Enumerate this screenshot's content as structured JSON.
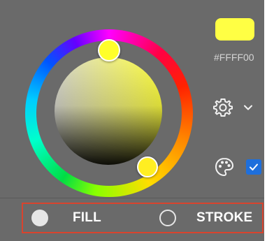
{
  "color": {
    "current_hex": "#FFFF00",
    "swatch_color": "#FFFF44"
  },
  "settings": {
    "icon": "gear-icon",
    "dropdown_icon": "chevron-down-icon"
  },
  "palette": {
    "icon": "palette-icon",
    "checked": true
  },
  "mode": {
    "fill_label": "FILL",
    "stroke_label": "STROKE",
    "selected": "fill"
  },
  "colors": {
    "panel_bg": "#6A6A6A",
    "accent_blue": "#1E6FDC",
    "highlight_border": "#D9442E"
  }
}
